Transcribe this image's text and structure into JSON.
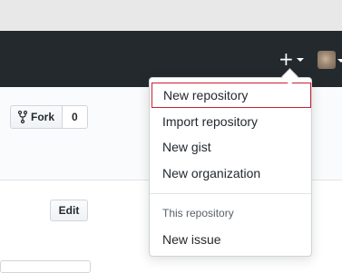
{
  "header": {
    "create_menu_icon": "plus-icon",
    "create_caret_icon": "caret-down-icon",
    "avatar_caret_icon": "caret-down-icon"
  },
  "repo": {
    "fork_icon": "fork-icon",
    "fork_label": "Fork",
    "fork_count": "0",
    "edit_label": "Edit"
  },
  "create_menu": {
    "items": [
      {
        "label": "New repository"
      },
      {
        "label": "Import repository"
      },
      {
        "label": "New gist"
      },
      {
        "label": "New organization"
      }
    ],
    "section_header": "This repository",
    "repo_items": [
      {
        "label": "New issue"
      }
    ]
  },
  "colors": {
    "header_bg": "#24292e",
    "focus_outline": "#c8202f",
    "subhead_bg": "#fafbfc"
  }
}
